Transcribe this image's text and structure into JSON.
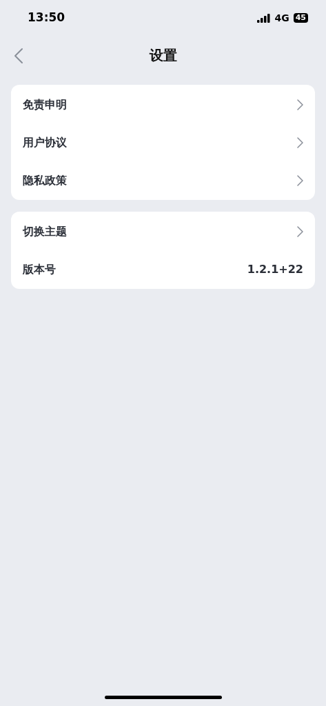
{
  "status_bar": {
    "time": "13:50",
    "network": "4G",
    "battery": "45"
  },
  "nav": {
    "title": "设置"
  },
  "groups": [
    {
      "items": [
        {
          "kind": "link",
          "label": "免责申明"
        },
        {
          "kind": "link",
          "label": "用户协议"
        },
        {
          "kind": "link",
          "label": "隐私政策"
        }
      ]
    },
    {
      "items": [
        {
          "kind": "link",
          "label": "切换主题"
        },
        {
          "kind": "value",
          "label": "版本号",
          "value": "1.2.1+22"
        }
      ]
    }
  ]
}
